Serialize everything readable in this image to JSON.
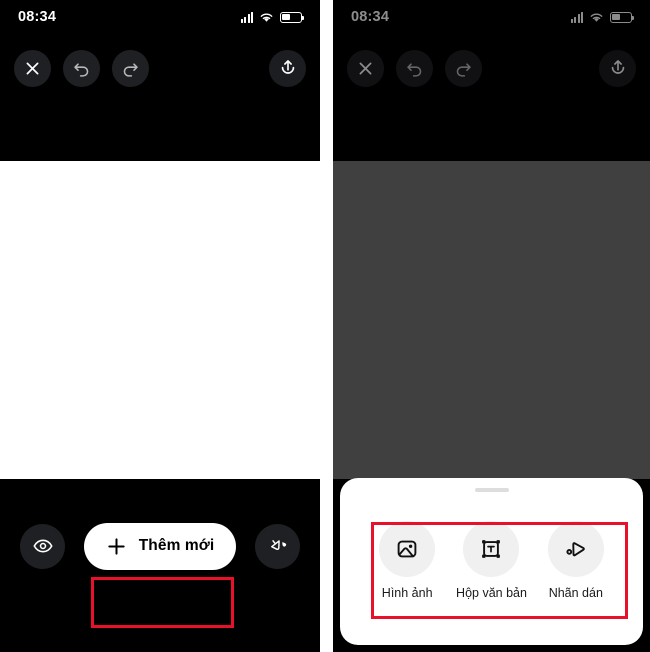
{
  "app": {
    "name": "video-photo-editor",
    "accent_red": "#e8102a",
    "dark_bg": "#000000",
    "canvas_white": "#ffffff",
    "canvas_gray": "#767676",
    "button_dark": "#1f2023"
  },
  "left_screen": {
    "status_bar": {
      "time": "08:34",
      "signal_icon": "cellular-signal-icon",
      "wifi_icon": "wifi-icon",
      "battery_icon": "battery-icon"
    },
    "toolbar": {
      "close_icon": "close-icon",
      "undo_icon": "undo-icon",
      "redo_icon": "redo-icon",
      "share_icon": "share-upload-icon"
    },
    "canvas": {
      "type": "blank-white-canvas"
    },
    "bottom_bar": {
      "preview_icon": "eye-icon",
      "add_label": "Thêm mới",
      "add_icon": "plus-icon",
      "fill_icon": "paint-bucket-icon"
    },
    "annotation": {
      "highlight": "add-new-button-highlight"
    }
  },
  "right_screen": {
    "status_bar": {
      "time": "08:34",
      "signal_icon": "cellular-signal-icon",
      "wifi_icon": "wifi-icon",
      "battery_icon": "battery-icon"
    },
    "toolbar": {
      "close_icon": "close-icon",
      "undo_icon": "undo-icon",
      "redo_icon": "redo-icon",
      "share_icon": "share-upload-icon"
    },
    "canvas": {
      "type": "dimmed-gray-canvas"
    },
    "bottom_sheet": {
      "handle": "drag-handle",
      "options": [
        {
          "label": "Hình ảnh",
          "icon": "image-icon"
        },
        {
          "label": "Hộp văn bản",
          "icon": "text-box-icon"
        },
        {
          "label": "Nhãn dán",
          "icon": "sticker-icon"
        }
      ]
    },
    "annotation": {
      "highlight": "sheet-options-highlight"
    }
  }
}
